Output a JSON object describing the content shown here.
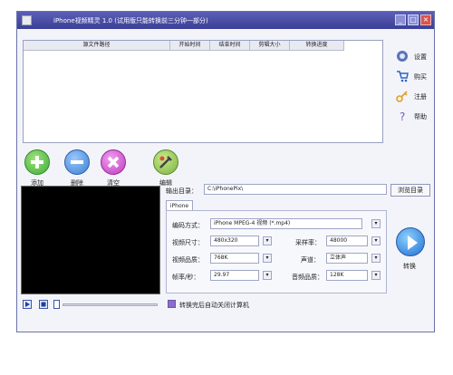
{
  "window": {
    "title": "iPhone视频精灵 1.0 (试用版只能转换前三分钟一部分)"
  },
  "file_list": {
    "columns": [
      "源文件路径",
      "开始时间",
      "结束时间",
      "剪辑大小",
      "转换进度"
    ]
  },
  "sidebar": {
    "items": [
      {
        "label": "设置",
        "icon": "settings-icon"
      },
      {
        "label": "购买",
        "icon": "cart-icon"
      },
      {
        "label": "注册",
        "icon": "key-icon"
      },
      {
        "label": "帮助",
        "icon": "help-icon"
      }
    ]
  },
  "toolbar": {
    "add_label": "添加",
    "delete_label": "删除",
    "clear_label": "清空",
    "edit_label": "编辑"
  },
  "output": {
    "label": "输出目录：",
    "path": "C:\\iPhonePix\\",
    "browse_label": "浏览目录"
  },
  "tab": {
    "label": "iPhone"
  },
  "settings": {
    "encoding": {
      "label": "编码方式：",
      "value": "iPhone MPEG-4 视频 (*.mp4)"
    },
    "video_size": {
      "label": "视频尺寸：",
      "value": "480x320"
    },
    "sample_rate": {
      "label": "采样率：",
      "value": "48000"
    },
    "video_quality": {
      "label": "视频品质：",
      "value": "768K"
    },
    "channels": {
      "label": "声道：",
      "value": "立体声"
    },
    "fps": {
      "label": "帧率/秒：",
      "value": "29.97"
    },
    "audio_quality": {
      "label": "音频品质：",
      "value": "128K"
    }
  },
  "convert": {
    "label": "转换"
  },
  "shutdown_option": {
    "label": "转换完后自动关闭计算机"
  },
  "colors": {
    "titlebar": "#4a4ea8",
    "add": "#3fae3a",
    "delete": "#3a7fd0",
    "clear": "#c039c0",
    "edit": "#7bb342"
  }
}
